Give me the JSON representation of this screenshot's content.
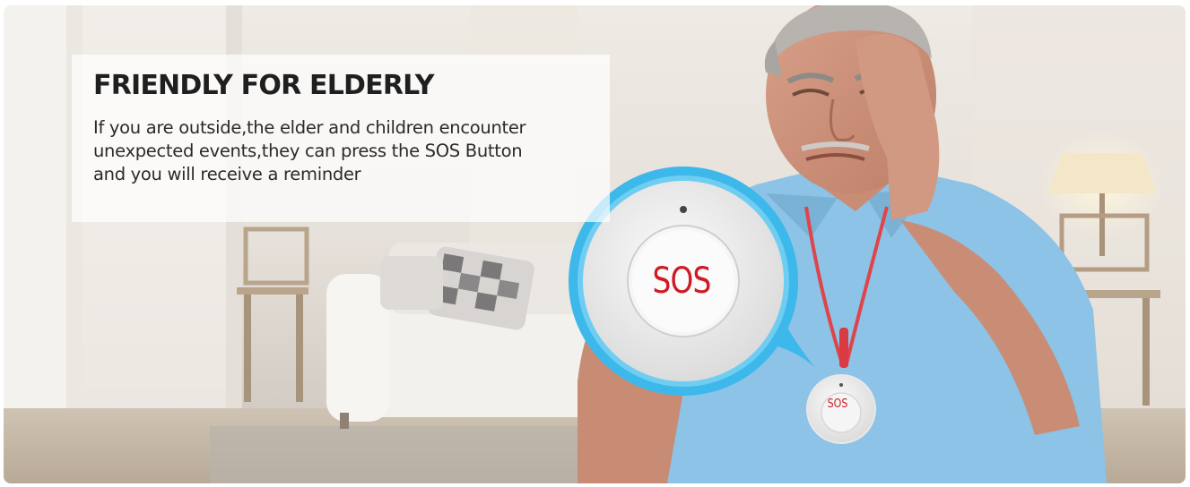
{
  "banner": {
    "headline": "FRIENDLY FOR ELDERLY",
    "body_lines": [
      "If you are outside,the elder and children encounter",
      "unexpected events,they can press the SOS Button",
      "and you will receive a reminder"
    ]
  },
  "device": {
    "large_button_label": "SOS",
    "pendant_button_label": "SOS",
    "label_color": "#d01b23",
    "ring_color": "#3db8ea"
  },
  "photo": {
    "shirt_color": "#8cc3e6",
    "lanyard_color": "#e0444b"
  }
}
